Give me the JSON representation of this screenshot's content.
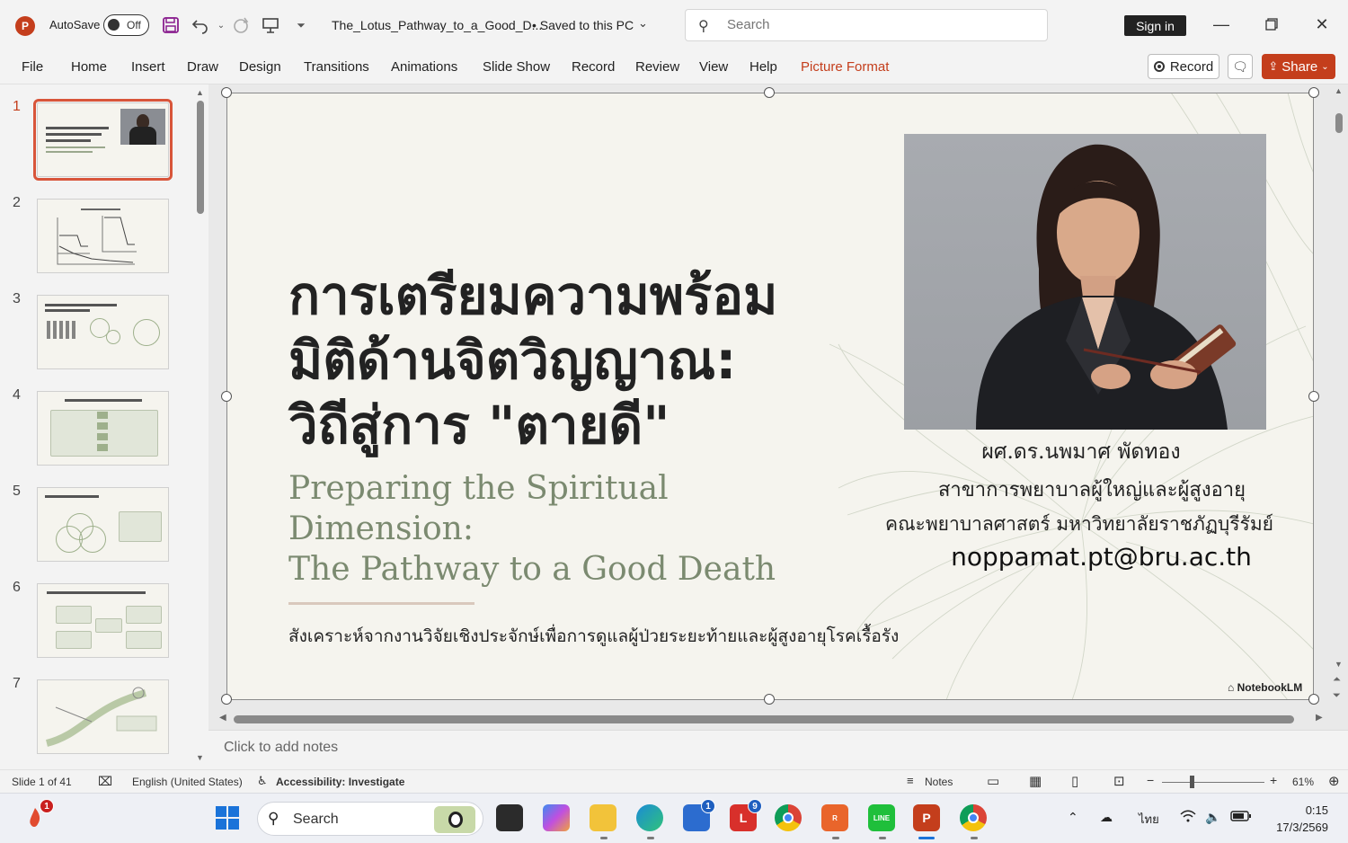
{
  "titlebar": {
    "app_logo": "P",
    "autosave_label": "AutoSave",
    "autosave_state": "Off",
    "doc_title": "The_Lotus_Pathway_to_a_Good_D...",
    "saved_status": "• Saved to this PC",
    "search_placeholder": "Search",
    "sign_in": "Sign in",
    "icons": [
      "save-icon",
      "undo-icon",
      "redo-icon",
      "present-icon",
      "customize-icon"
    ]
  },
  "ribbon": {
    "tabs": [
      "File",
      "Home",
      "Insert",
      "Draw",
      "Design",
      "Transitions",
      "Animations",
      "Slide Show",
      "Record",
      "Review",
      "View",
      "Help",
      "Picture Format"
    ],
    "active_tab": "Picture Format",
    "record_label": "Record",
    "share_label": "Share"
  },
  "thumbnails": {
    "numbers": [
      "1",
      "2",
      "3",
      "4",
      "5",
      "6",
      "7"
    ],
    "selected": "1"
  },
  "slide": {
    "title_lines": [
      "การเตรียมความพร้อม",
      "มิติด้านจิตวิญญาณ:",
      "วิถีสู่การ \"ตายดี\""
    ],
    "subtitle_lines": [
      "Preparing the Spiritual Dimension:",
      "The Pathway to a Good Death"
    ],
    "caption": "สังเคราะห์จากงานวิจัยเชิงประจักษ์เพื่อการดูแลผู้ป่วยระยะท้ายและผู้สูงอายุโรคเรื้อรัง",
    "author_lines": [
      "ผศ.ดร.นพมาศ พัดทอง",
      "สาขาการพยาบาลผู้ใหญ่และผู้สูงอายุ",
      "คณะพยาบาลศาสตร์ มหาวิทยาลัยราชภัฏบุรีรัมย์"
    ],
    "email": "noppamat.pt@bru.ac.th",
    "watermark": "NotebookLM"
  },
  "notes_placeholder": "Click to add notes",
  "statusbar": {
    "slide_counter": "Slide 1 of 41",
    "language": "English (United States)",
    "accessibility": "Accessibility: Investigate",
    "notes_label": "Notes",
    "zoom": "61%"
  },
  "taskbar": {
    "search_label": "Search",
    "lang": "ไทย",
    "time": "0:15",
    "date": "17/3/2569",
    "badges": {
      "notif": "1",
      "store": "1",
      "lapp": "9"
    }
  },
  "colors": {
    "accent": "#c43e1c",
    "subtitle": "#7b8a70",
    "slide_bg": "#f5f4ee"
  }
}
